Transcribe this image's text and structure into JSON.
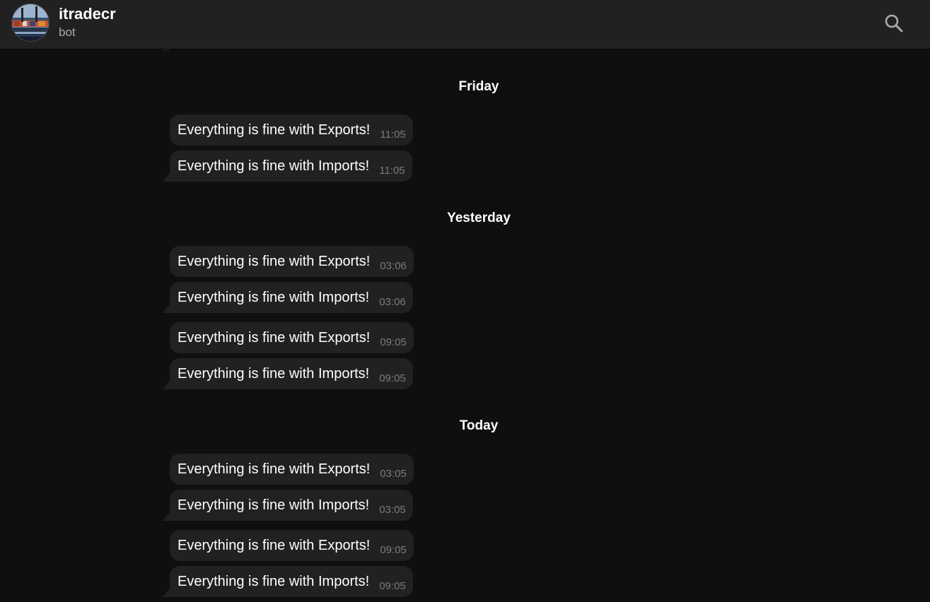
{
  "header": {
    "title": "itradecr",
    "subtitle": "bot",
    "search_icon": "search-icon"
  },
  "dates": [
    "Friday",
    "Yesterday",
    "Today"
  ],
  "messages": [
    {
      "text": "Everything is fine with Exports!",
      "time": "11:05"
    },
    {
      "text": "Everything is fine with Imports!",
      "time": "11:05"
    },
    {
      "text": "Everything is fine with Exports!",
      "time": "03:06"
    },
    {
      "text": "Everything is fine with Imports!",
      "time": "03:06"
    },
    {
      "text": "Everything is fine with Exports!",
      "time": "09:05"
    },
    {
      "text": "Everything is fine with Imports!",
      "time": "09:05"
    },
    {
      "text": "Everything is fine with Exports!",
      "time": "03:05"
    },
    {
      "text": "Everything is fine with Imports!",
      "time": "03:05"
    },
    {
      "text": "Everything is fine with Exports!",
      "time": "09:05"
    },
    {
      "text": "Everything is fine with Imports!",
      "time": "09:05"
    }
  ],
  "colors": {
    "background": "#0f0f0f",
    "header": "#212121",
    "bubble": "#212121",
    "text": "#ffffff",
    "muted": "#aaaaaa"
  }
}
